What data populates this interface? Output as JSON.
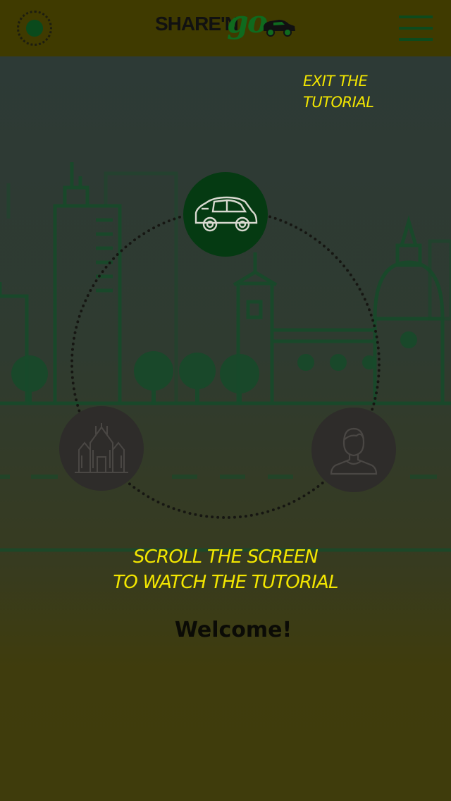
{
  "header": {
    "logo_text_share": "SHARE'N",
    "logo_text_go": "go",
    "menu_icon": "hamburger-menu-icon",
    "status_icon": "dotted-circle-status-icon"
  },
  "tutorial": {
    "exit_line1": "EXIT THE",
    "exit_line2": "TUTORIAL",
    "scroll_line1": "SCROLL THE SCREEN",
    "scroll_line2": "TO WATCH THE TUTORIAL",
    "welcome": "Welcome!",
    "steps": [
      {
        "icon": "car-icon",
        "active": true
      },
      {
        "icon": "cathedral-icon",
        "active": false
      },
      {
        "icon": "user-icon",
        "active": false
      }
    ]
  },
  "colors": {
    "topbar": "#3f3a00",
    "accent_yellow": "#f3e600",
    "brand_green": "#0f6a1e",
    "active_step": "#053a12",
    "inactive_step": "#2e2c2a"
  }
}
